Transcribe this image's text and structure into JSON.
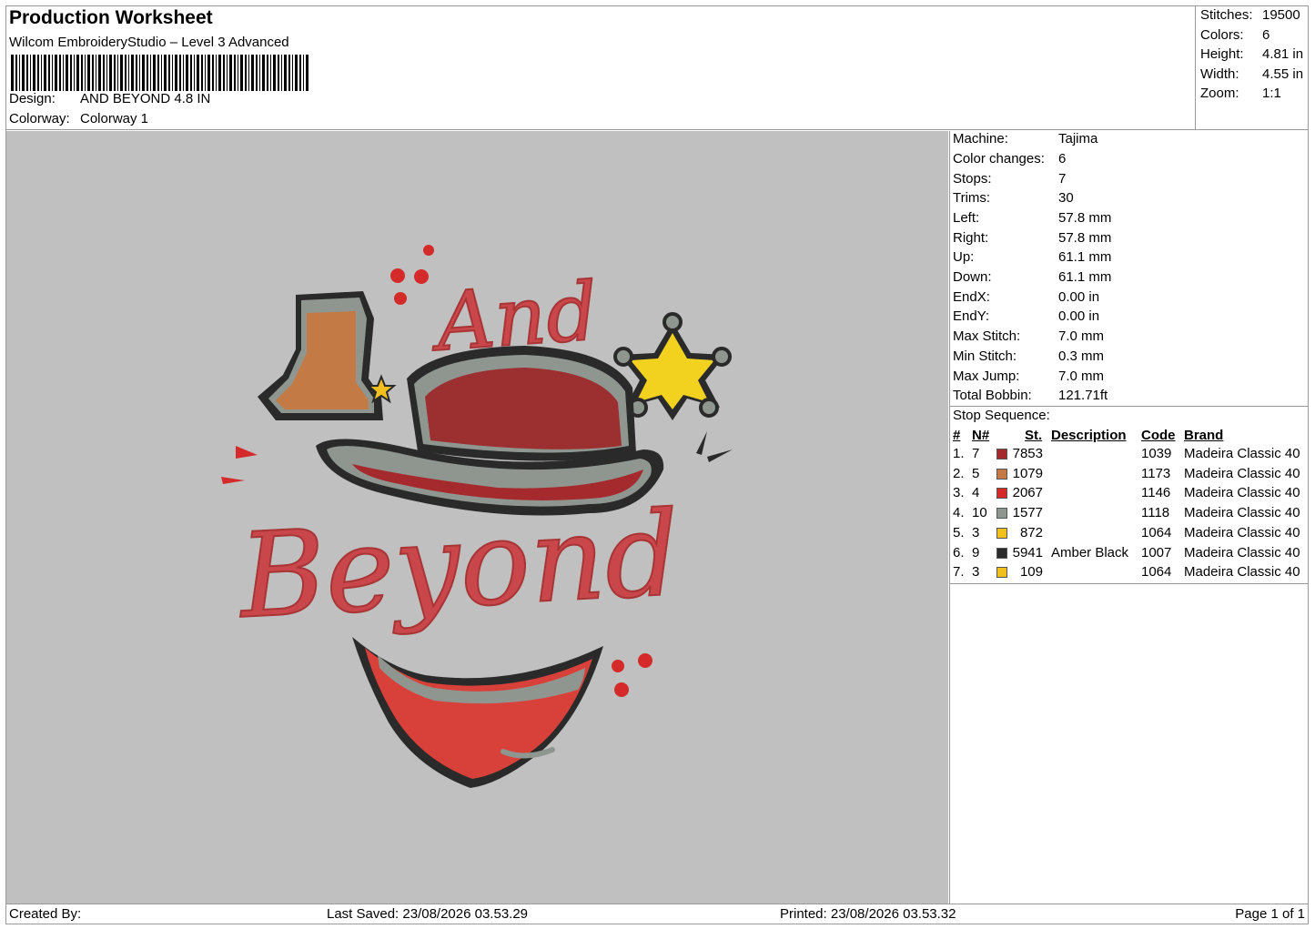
{
  "header": {
    "title": "Production Worksheet",
    "subtitle": "Wilcom EmbroideryStudio – Level 3 Advanced",
    "design_label": "Design:",
    "design_value": "AND BEYOND 4.8 IN",
    "colorway_label": "Colorway:",
    "colorway_value": "Colorway 1"
  },
  "summary": [
    {
      "label": "Stitches:",
      "value": "19500"
    },
    {
      "label": "Colors:",
      "value": "6"
    },
    {
      "label": "Height:",
      "value": "4.81 in"
    },
    {
      "label": "Width:",
      "value": "4.55 in"
    },
    {
      "label": "Zoom:",
      "value": "1:1"
    }
  ],
  "design_text": {
    "small": "And",
    "large": "Beyond"
  },
  "machine_info": [
    {
      "label": "Machine:",
      "value": "Tajima"
    },
    {
      "label": "Color changes:",
      "value": "6"
    },
    {
      "label": "Stops:",
      "value": "7"
    },
    {
      "label": "Trims:",
      "value": "30"
    },
    {
      "label": "Left:",
      "value": "57.8 mm"
    },
    {
      "label": "Right:",
      "value": "57.8 mm"
    },
    {
      "label": "Up:",
      "value": "61.1 mm"
    },
    {
      "label": "Down:",
      "value": "61.1 mm"
    },
    {
      "label": "EndX:",
      "value": "0.00 in"
    },
    {
      "label": "EndY:",
      "value": "0.00 in"
    },
    {
      "label": "Max Stitch:",
      "value": "7.0 mm"
    },
    {
      "label": "Min Stitch:",
      "value": "0.3 mm"
    },
    {
      "label": "Max Jump:",
      "value": "7.0 mm"
    },
    {
      "label": "Total Bobbin:",
      "value": "121.71ft"
    }
  ],
  "stop_sequence": {
    "title": "Stop Sequence:",
    "headers": {
      "num": "#",
      "n": "N#",
      "st": "St.",
      "description": "Description",
      "code": "Code",
      "brand": "Brand"
    },
    "rows": [
      {
        "num": "1.",
        "n": "7",
        "color": "#a52a2e",
        "st": "7853",
        "description": "",
        "code": "1039",
        "brand": "Madeira Classic 40"
      },
      {
        "num": "2.",
        "n": "5",
        "color": "#c47a45",
        "st": "1079",
        "description": "",
        "code": "1173",
        "brand": "Madeira Classic 40"
      },
      {
        "num": "3.",
        "n": "4",
        "color": "#d42a2a",
        "st": "2067",
        "description": "",
        "code": "1146",
        "brand": "Madeira Classic 40"
      },
      {
        "num": "4.",
        "n": "10",
        "color": "#8f9690",
        "st": "1577",
        "description": "",
        "code": "1118",
        "brand": "Madeira Classic 40"
      },
      {
        "num": "5.",
        "n": "3",
        "color": "#f2c01e",
        "st": "872",
        "description": "",
        "code": "1064",
        "brand": "Madeira Classic 40"
      },
      {
        "num": "6.",
        "n": "9",
        "color": "#2a2a2a",
        "st": "5941",
        "description": "Amber Black",
        "code": "1007",
        "brand": "Madeira Classic 40"
      },
      {
        "num": "7.",
        "n": "3",
        "color": "#f2c01e",
        "st": "109",
        "description": "",
        "code": "1064",
        "brand": "Madeira Classic 40"
      }
    ]
  },
  "footer": {
    "created_by": "Created By:",
    "last_saved": "Last Saved: 23/08/2026 03.53.29",
    "printed": "Printed: 23/08/2026 03.53.32",
    "page": "Page 1 of 1"
  }
}
